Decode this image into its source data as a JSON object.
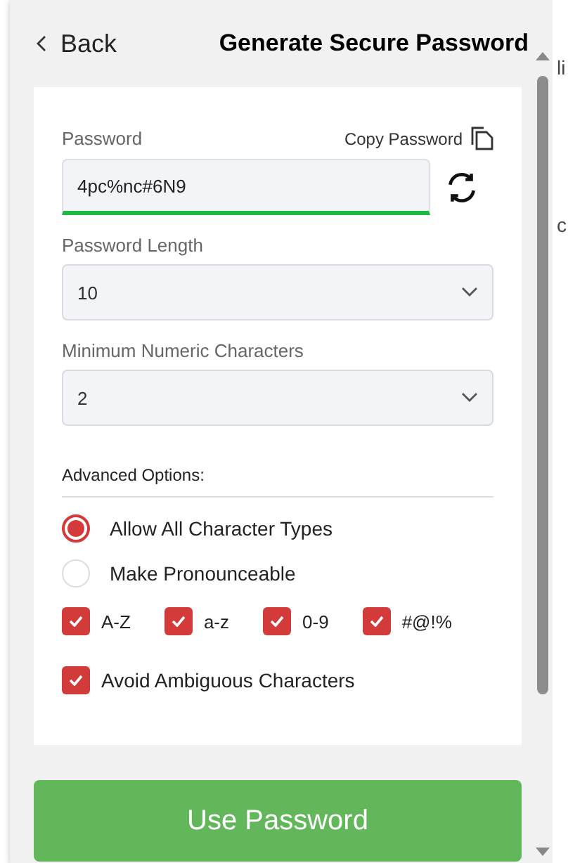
{
  "header": {
    "back": "Back",
    "title": "Generate Secure Password"
  },
  "password": {
    "label": "Password",
    "copy": "Copy Password",
    "value": "4pc%nc#6N9"
  },
  "selects": [
    {
      "label": "Password Length",
      "value": "10"
    },
    {
      "label": "Minimum Numeric Characters",
      "value": "2"
    }
  ],
  "advanced": {
    "title": "Advanced Options:"
  },
  "modes": [
    {
      "label": "Allow All Character Types",
      "selected": true
    },
    {
      "label": "Make Pronounceable",
      "selected": false
    }
  ],
  "charsets": [
    {
      "label": "A-Z",
      "checked": true
    },
    {
      "label": "a-z",
      "checked": true
    },
    {
      "label": "0-9",
      "checked": true
    },
    {
      "label": "#@!%",
      "checked": true
    }
  ],
  "avoid": {
    "label": "Avoid Ambiguous Characters",
    "checked": true
  },
  "action": "Use Password",
  "background_fragments": [
    "li",
    "c"
  ]
}
